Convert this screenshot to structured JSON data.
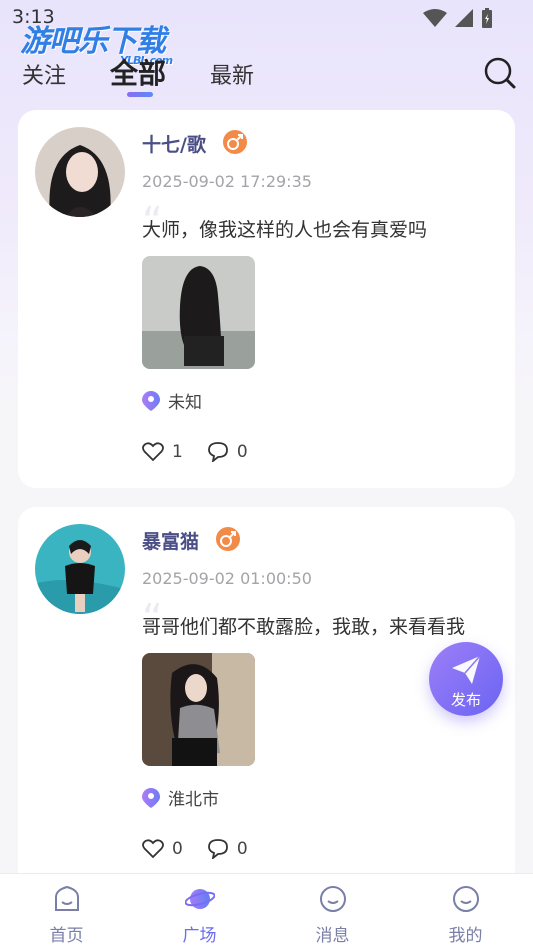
{
  "status_bar": {
    "time": "3:13"
  },
  "watermark": {
    "brand": "游吧乐下载",
    "sub": "YLBL.com"
  },
  "tabs": [
    {
      "label": "关注",
      "active": false
    },
    {
      "label": "全部",
      "active": true
    },
    {
      "label": "最新",
      "active": false
    }
  ],
  "posts": [
    {
      "name": "十七/歌",
      "time": "2025-09-02 17:29:35",
      "content": "大师，像我这样的人也会有真爱吗",
      "location": "未知",
      "likes": "1",
      "comments": "0"
    },
    {
      "name": "暴富猫",
      "time": "2025-09-02 01:00:50",
      "content": "哥哥他们都不敢露脸，我敢，来看看我",
      "location": "淮北市",
      "likes": "0",
      "comments": "0"
    }
  ],
  "publish_label": "发布",
  "nav": [
    {
      "label": "首页",
      "icon": "home-icon"
    },
    {
      "label": "广场",
      "icon": "planet-icon",
      "active": true
    },
    {
      "label": "消息",
      "icon": "message-icon"
    },
    {
      "label": "我的",
      "icon": "profile-icon"
    }
  ],
  "colors": {
    "accent": "#6a6cf3",
    "name": "#4b4f86",
    "gender_badge": "#f28a48"
  }
}
